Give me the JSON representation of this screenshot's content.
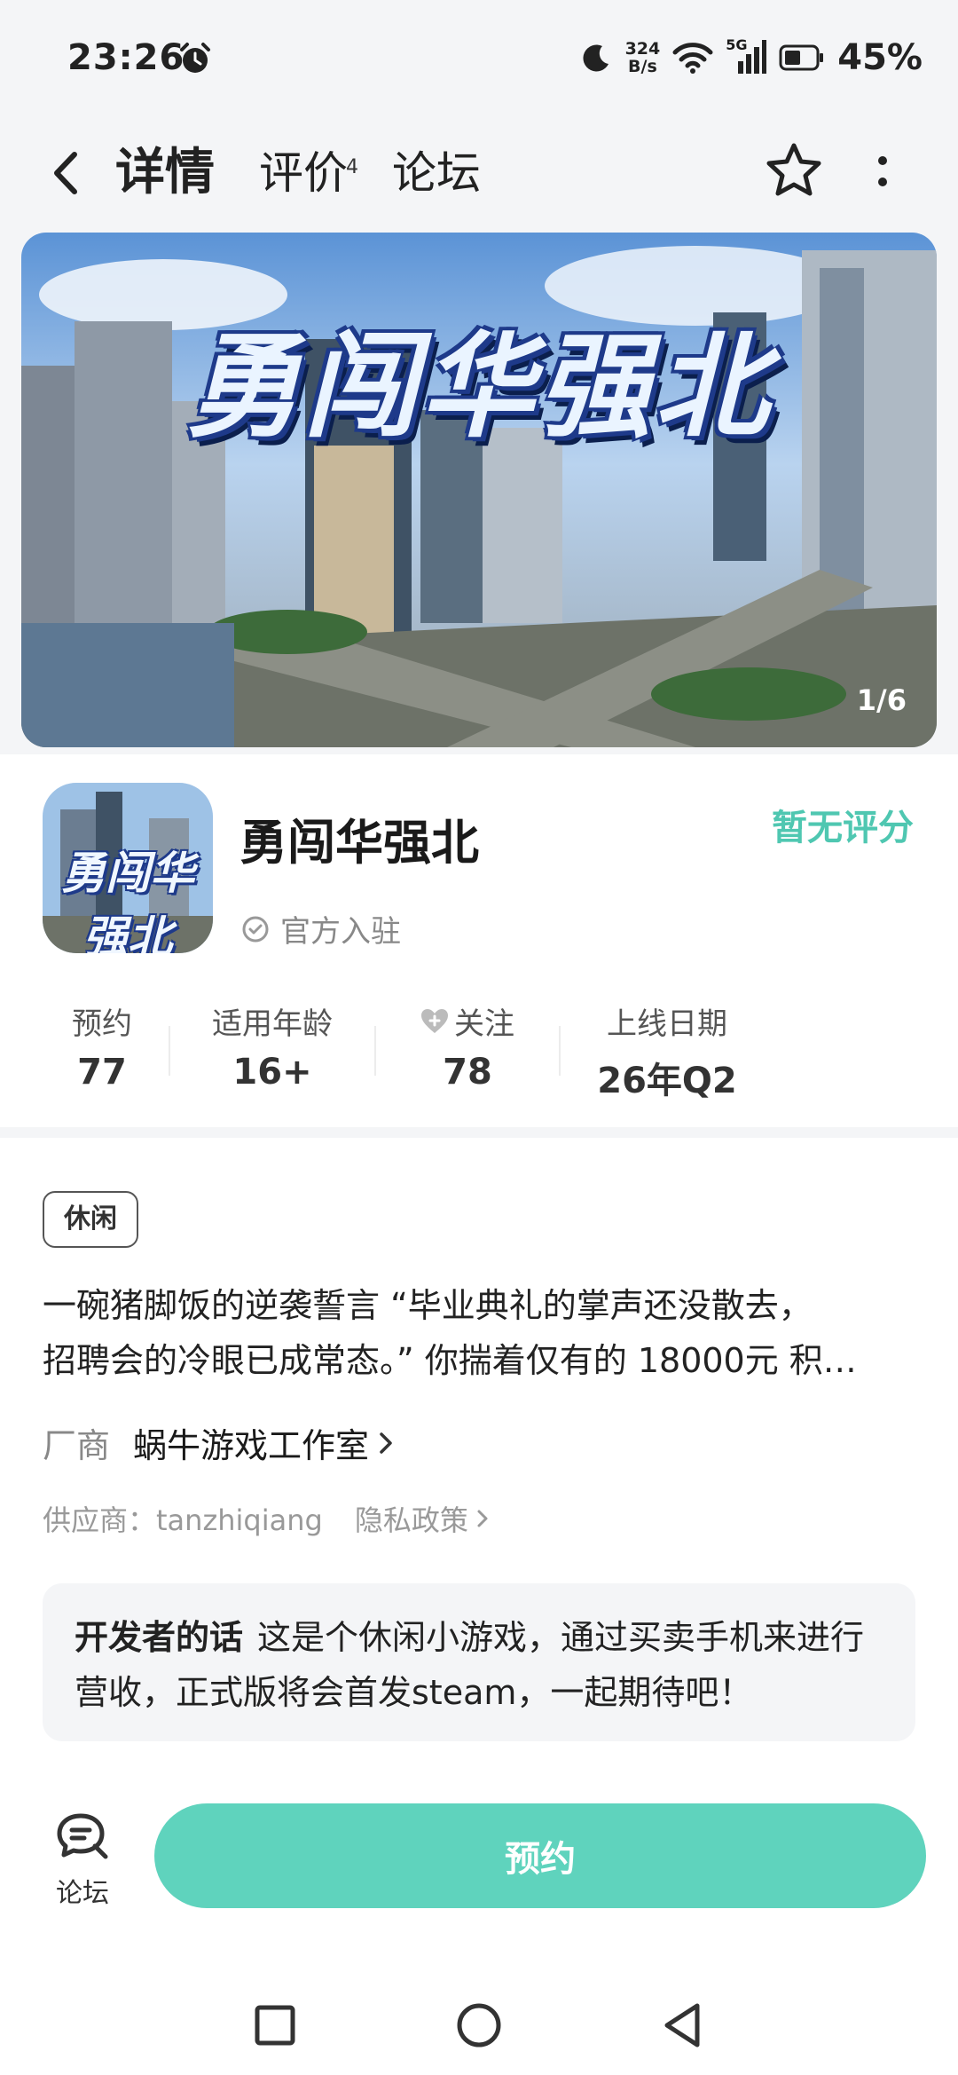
{
  "status_bar": {
    "time": "23:26",
    "net_speed_value": "324",
    "net_speed_unit": "B/s",
    "network": "5G",
    "battery": "45%"
  },
  "nav": {
    "tabs": [
      {
        "label": "详情",
        "active": true
      },
      {
        "label": "评价",
        "badge": "4"
      },
      {
        "label": "论坛"
      }
    ]
  },
  "banner": {
    "title": "勇闯华强北",
    "counter": "1/6"
  },
  "app": {
    "icon_title": "勇闯华强北",
    "name": "勇闯华强北",
    "official_label": "官方入驻",
    "rating": "暂无评分"
  },
  "stats": [
    {
      "label": "预约",
      "value": "77"
    },
    {
      "label": "适用年龄",
      "value": "16+"
    },
    {
      "label": "关注",
      "value": "78"
    },
    {
      "label": "上线日期",
      "value": "26年Q2"
    }
  ],
  "tag": "休闲",
  "description": {
    "line1": "一碗猪脚饭的逆袭誓言 “毕业典礼的掌声还没散去，",
    "line2": "招聘会的冷眼已成常态。” 你揣着仅有的 18000元 积…"
  },
  "vendor": {
    "key": "厂商",
    "value": "蜗牛游戏工作室"
  },
  "supplier": {
    "text": "供应商：tanzhiqiang",
    "privacy": "隐私政策"
  },
  "developer": {
    "title": "开发者的话",
    "text": "这是个休闲小游戏，通过买卖手机来进行营收，正式版将会首发steam，一起期待吧！"
  },
  "bottom": {
    "forum_label": "论坛",
    "reserve_label": "预约"
  },
  "colors": {
    "accent": "#5fd3bd",
    "rating": "#4fc7b1",
    "background": "#f4f5f7"
  },
  "icons": [
    "alarm-icon",
    "moon-icon",
    "wifi-icon",
    "signal-icon",
    "battery-icon",
    "back-icon",
    "star-outline-icon",
    "more-vertical-icon",
    "check-circle-icon",
    "heart-plus-icon",
    "chevron-right-icon",
    "forum-chat-icon",
    "square-nav-icon",
    "circle-nav-icon",
    "triangle-back-nav-icon"
  ]
}
